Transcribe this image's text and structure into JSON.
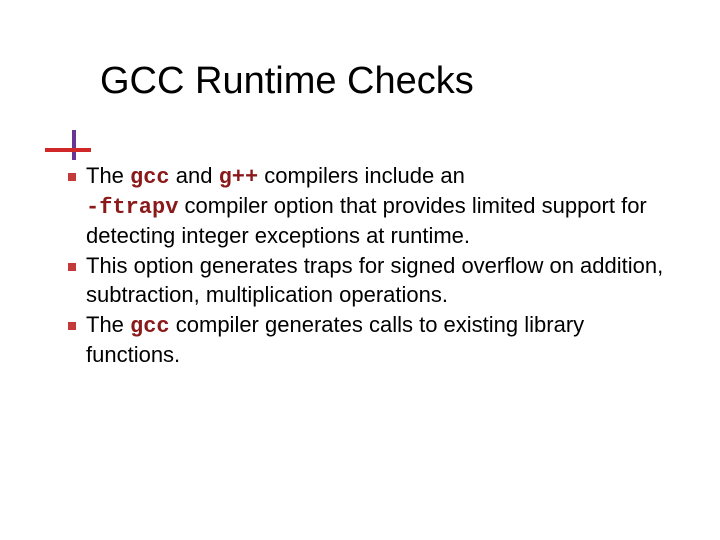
{
  "title": "GCC Runtime Checks",
  "bullets": [
    {
      "pre1": "The ",
      "code1": "gcc",
      "mid1": " and ",
      "code2": "g++",
      "mid2": " compilers include an ",
      "code3": "-ftrapv",
      "post": " compiler option that provides limited support for detecting integer exceptions at runtime."
    },
    {
      "text": "This option generates traps for signed overflow on addition, subtraction, multiplication operations."
    },
    {
      "pre1": "The ",
      "code1": "gcc",
      "post": " compiler generates calls to existing library functions."
    }
  ]
}
